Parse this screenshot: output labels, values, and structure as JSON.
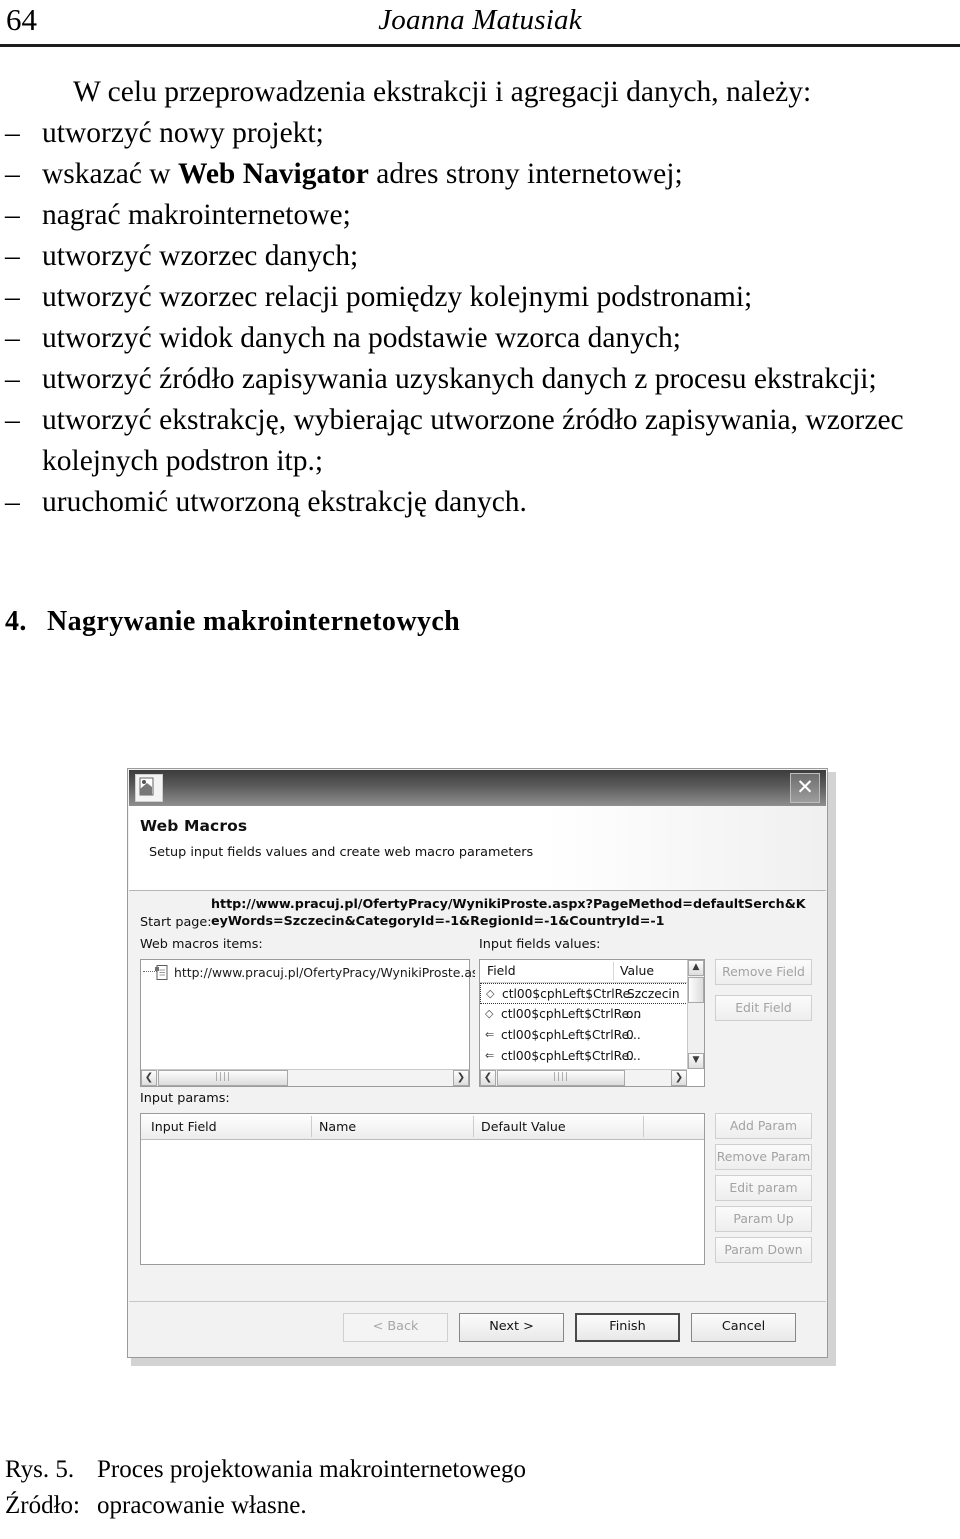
{
  "page": {
    "folio": "64",
    "running_title": "Joanna Matusiak"
  },
  "body": {
    "lead": "W celu przeprowadzenia ekstrakcji i agregacji danych, należy:",
    "bullet_marker": "–",
    "items": [
      {
        "text": "utworzyć nowy projekt;"
      },
      {
        "pre": "wskazać w ",
        "bold": "Web Navigator",
        "post": " adres strony internetowej;"
      },
      {
        "text": "nagrać makrointernetowe;"
      },
      {
        "text": "utworzyć wzorzec danych;"
      },
      {
        "text": "utworzyć wzorzec relacji pomiędzy kolejnymi podstronami;"
      },
      {
        "text": "utworzyć widok danych na podstawie wzorca danych;"
      },
      {
        "text": "utworzyć źródło zapisywania uzyskanych danych z procesu ekstrakcji;"
      },
      {
        "text": "utworzyć ekstrakcję, wybierając utworzone źródło zapisywania, wzorzec kolejnych podstron itp.;"
      },
      {
        "text": "uruchomić utworzoną ekstrakcję danych."
      }
    ]
  },
  "section": {
    "number": "4.",
    "title": "Nagrywanie makrointernetowych"
  },
  "dialog": {
    "close_label": "✕",
    "wizard_title": "Web Macros",
    "wizard_subtitle": "Setup input fields values and create web macro parameters",
    "start_page_label": "Start page:",
    "start_page_value": "http://www.pracuj.pl/OfertyPracy/WynikiProste.aspx?PageMethod=defaultSerch&KeyWords=Szczecin&CategoryId=-1&RegionId=-1&CountryId=-1",
    "macros_items_label": "Web macros items:",
    "input_fields_label": "Input fields values:",
    "tree": {
      "items": [
        {
          "label": "http://www.pracuj.pl/OfertyPracy/WynikiProste.as"
        }
      ]
    },
    "fields_grid": {
      "columns": [
        "Field",
        "Value"
      ],
      "rows": [
        {
          "glyph": "◇",
          "field": "ctl00$cphLeft$CtrlRe...",
          "value": "Szczecin",
          "selected": true
        },
        {
          "glyph": "◇",
          "field": "ctl00$cphLeft$CtrlRe...",
          "value": "on",
          "selected": false
        },
        {
          "glyph": "⇐",
          "field": "ctl00$cphLeft$CtrlRe...",
          "value": "0",
          "selected": false
        },
        {
          "glyph": "⇐",
          "field": "ctl00$cphLeft$CtrlRe...",
          "value": "0",
          "selected": false
        }
      ]
    },
    "field_buttons": [
      {
        "label": "Remove Field",
        "enabled": false
      },
      {
        "label": "Edit Field",
        "enabled": false
      }
    ],
    "input_params_label": "Input params:",
    "params_grid": {
      "columns": [
        "Input Field",
        "Name",
        "Default Value"
      ],
      "rows": []
    },
    "param_buttons": [
      {
        "label": "Add Param",
        "enabled": false
      },
      {
        "label": "Remove Param",
        "enabled": false
      },
      {
        "label": "Edit param",
        "enabled": false
      },
      {
        "label": "Param Up",
        "enabled": false
      },
      {
        "label": "Param Down",
        "enabled": false
      }
    ],
    "footer_buttons": [
      {
        "label": "< Back",
        "state": "disabled"
      },
      {
        "label": "Next >",
        "state": "normal"
      },
      {
        "label": "Finish",
        "state": "default"
      },
      {
        "label": "Cancel",
        "state": "normal"
      }
    ],
    "scroll": {
      "up_arrow": "▲",
      "down_arrow": "▼",
      "left_arrow": "❮",
      "right_arrow": "❯",
      "grip": "||||"
    }
  },
  "caption": {
    "figure_number": "Rys. 5.",
    "figure_text": "Proces projektowania makrointernetowego",
    "source_label": "Źródło:",
    "source_text": "opracowanie własne."
  }
}
